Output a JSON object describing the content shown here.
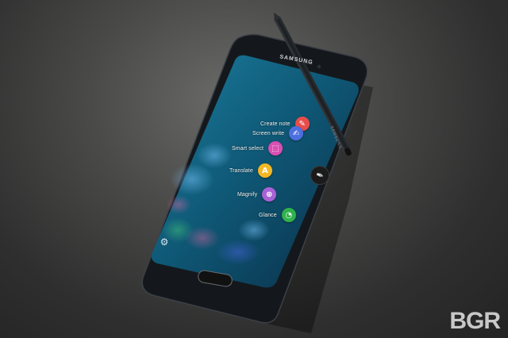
{
  "phone": {
    "brand": "SAMSUNG",
    "stylus_brand": "SAMSUNG"
  },
  "air_command": {
    "items": [
      {
        "label": "Create note",
        "icon": "pen-note-icon",
        "color": "#e94d4b",
        "glyph": "✎"
      },
      {
        "label": "Screen write",
        "icon": "screen-write-icon",
        "color": "#4c6fe0",
        "glyph": "✍"
      },
      {
        "label": "Smart select",
        "icon": "smart-select-icon",
        "color": "#d94fb3",
        "glyph": "⬚"
      },
      {
        "label": "Translate",
        "icon": "translate-icon",
        "color": "#f2b824",
        "glyph": "A"
      },
      {
        "label": "Magnify",
        "icon": "magnify-icon",
        "color": "#a962d6",
        "glyph": "⊕"
      },
      {
        "label": "Glance",
        "icon": "glance-icon",
        "color": "#2fb24b",
        "glyph": "◔"
      }
    ],
    "pen_button_glyph": "✒",
    "settings_glyph": "⚙"
  },
  "watermark": "BGR",
  "colors": {
    "screen_base": "#0d5d7a",
    "phone_body": "#15191d",
    "stylus": "#1d2023"
  }
}
